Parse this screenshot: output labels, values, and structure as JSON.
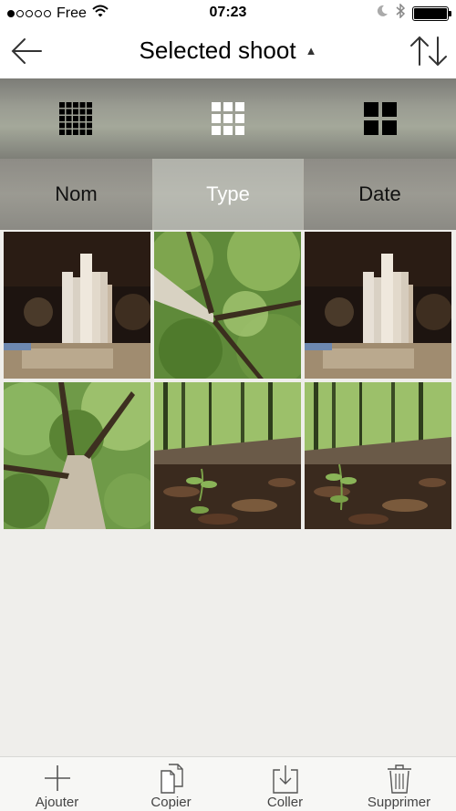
{
  "status_bar": {
    "carrier": "Free",
    "time": "07:23",
    "signal_bars_filled": 1,
    "signal_bars_total": 5,
    "battery_level": 1.0
  },
  "nav": {
    "title": "Selected shoot",
    "title_arrow": "▲",
    "back_icon": "arrow-left-icon",
    "sort_icon": "sort-arrows-icon"
  },
  "grid_options": [
    {
      "name": "grid-5x5",
      "selected": false
    },
    {
      "name": "grid-3x3",
      "selected": true
    },
    {
      "name": "grid-2x2",
      "selected": false
    }
  ],
  "sort_tabs": [
    {
      "label": "Nom",
      "selected": false
    },
    {
      "label": "Type",
      "selected": true
    },
    {
      "label": "Date",
      "selected": false
    }
  ],
  "photos": [
    {
      "subject": "bookshelf"
    },
    {
      "subject": "tree-canopy"
    },
    {
      "subject": "bookshelf"
    },
    {
      "subject": "tree-trunk"
    },
    {
      "subject": "forest-floor"
    },
    {
      "subject": "forest-floor"
    }
  ],
  "toolbar": [
    {
      "label": "Ajouter",
      "icon": "plus-icon"
    },
    {
      "label": "Copier",
      "icon": "copy-icon"
    },
    {
      "label": "Coller",
      "icon": "paste-icon"
    },
    {
      "label": "Supprimer",
      "icon": "trash-icon"
    }
  ],
  "colors": {
    "selected_tab_text": "#ffffff",
    "toolbar_label": "#444444",
    "background": "#efeeeb"
  }
}
